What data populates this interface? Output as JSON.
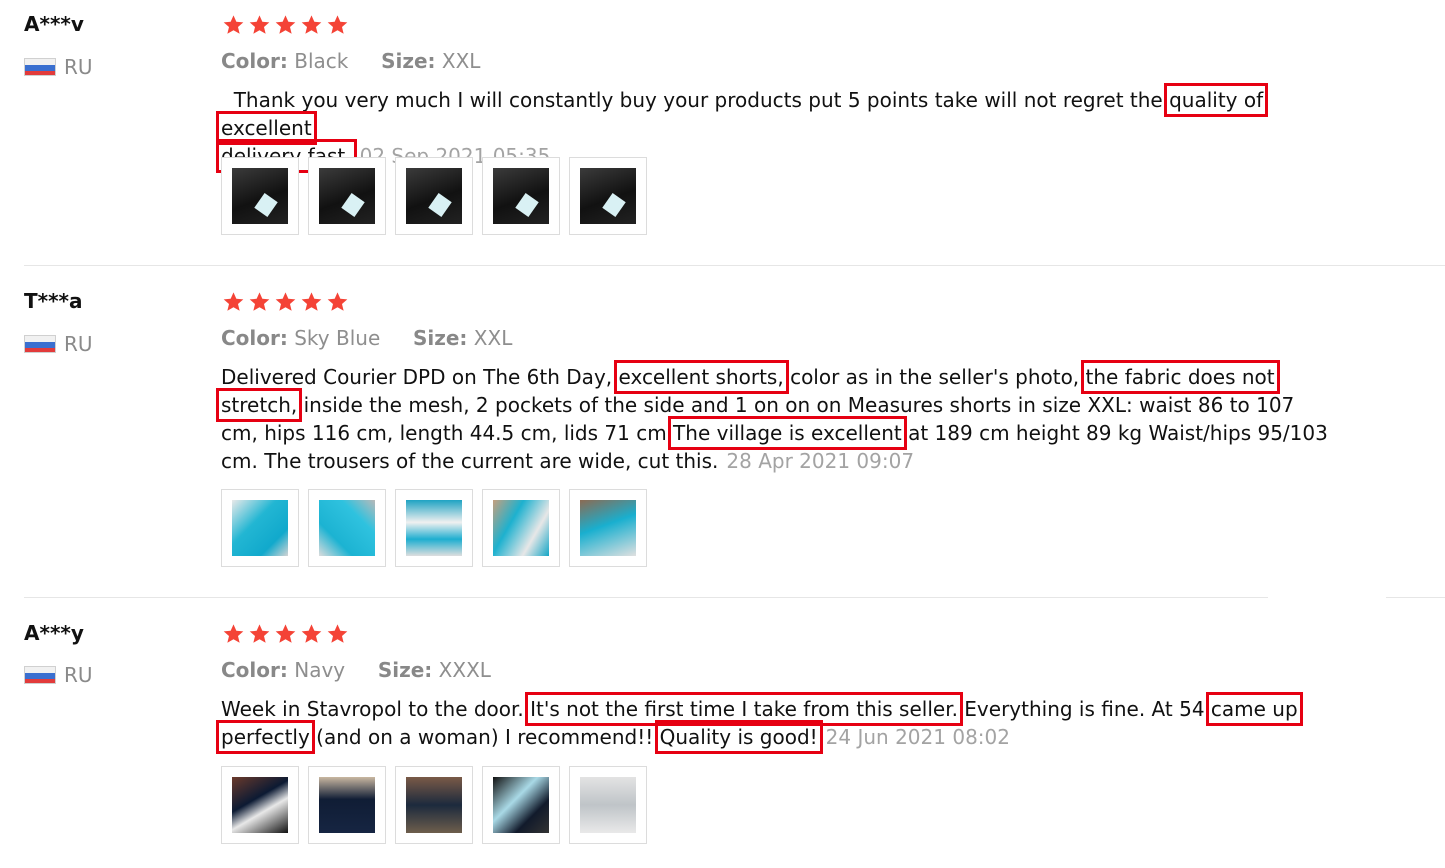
{
  "reviews": [
    {
      "user": "A***v",
      "country": "RU",
      "rating": 5,
      "color_label": "Color:",
      "color_value": "Black",
      "size_label": "Size:",
      "size_value": "XXL",
      "text_segments": [
        "  Thank you very much I will constantly buy your products put 5 points take will not regret the ",
        "quality of excellent",
        " ",
        "delivery fast."
      ],
      "date": "02 Sep 2021 05:35",
      "photos": [
        "black-shorts-photo",
        "black-shorts-photo",
        "black-shorts-photo",
        "black-shorts-photo",
        "black-shorts-photo"
      ]
    },
    {
      "user": "T***a",
      "country": "RU",
      "rating": 5,
      "color_label": "Color:",
      "color_value": "Sky Blue",
      "size_label": "Size:",
      "size_value": "XXL",
      "text_segments": [
        "Delivered Courier DPD on The 6th Day,",
        "excellent shorts,",
        " color as in the seller's photo,",
        "the fabric does not stretch,",
        " inside the mesh, 2 pockets of the side and 1 on on on Measures shorts in size XXL: waist 86 to 107 cm, hips 116 cm, length 44.5 cm, lids 71 cm ",
        "The village is excellent",
        " at 189 cm height 89 kg Waist/hips 95/103 cm. The trousers of the current are wide, cut this."
      ],
      "date": "28 Apr 2021 09:07",
      "photos": [
        "blue-shorts-photo",
        "blue-shorts-photo",
        "blue-shorts-photo",
        "blue-shorts-photo",
        "blue-shorts-photo"
      ]
    },
    {
      "user": "A***y",
      "country": "RU",
      "rating": 5,
      "color_label": "Color:",
      "color_value": "Navy",
      "size_label": "Size:",
      "size_value": "XXXL",
      "text_segments": [
        "Week in Stavropol to the door. ",
        "It's not the first time I take from this seller.",
        " Everything is fine. At 54 ",
        "came up perfectly",
        " (and on a woman) I recommend!! ",
        "Quality is good!"
      ],
      "date": "24 Jun 2021 08:02",
      "photos": [
        "navy-shorts-photo",
        "navy-shorts-photo",
        "navy-shorts-photo",
        "navy-shorts-photo",
        "navy-shorts-photo"
      ]
    }
  ],
  "colors": {
    "star": "#f44336",
    "highlight_box": "#e60012",
    "meta_text": "#8e8e8e",
    "date_text": "#a3a3a3"
  }
}
